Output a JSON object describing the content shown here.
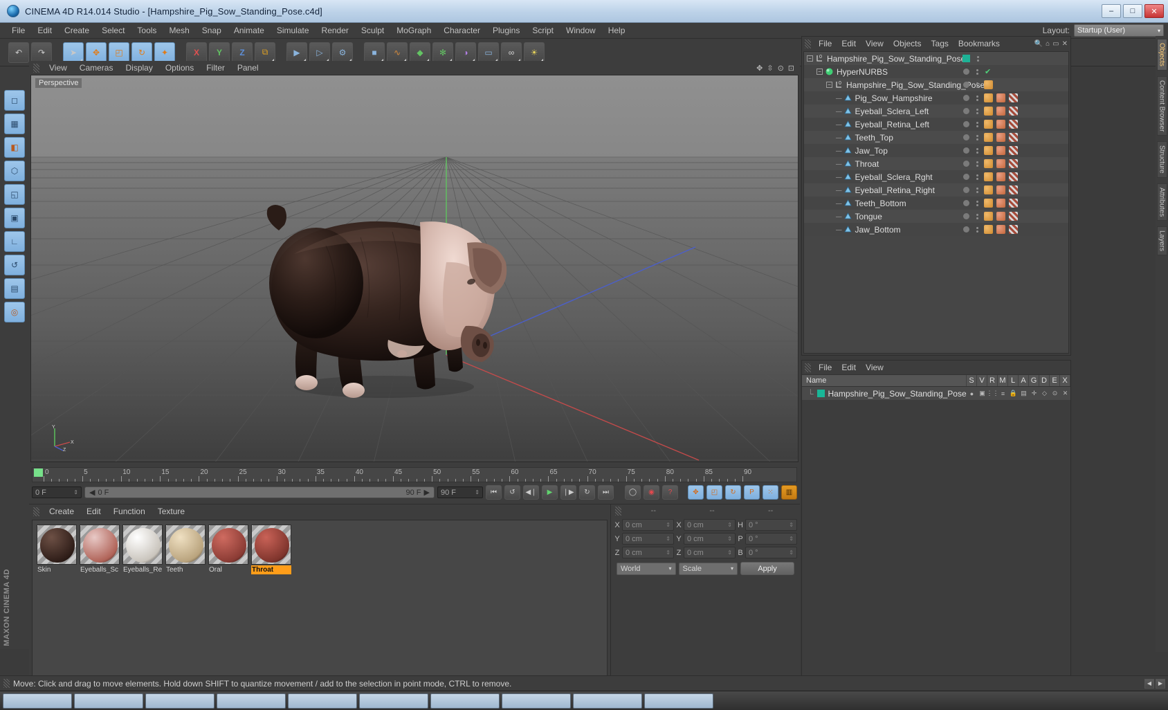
{
  "window": {
    "title": "CINEMA 4D R14.014 Studio - [Hampshire_Pig_Sow_Standing_Pose.c4d]",
    "app_icon": "c4d-logo-icon",
    "minimize": "–",
    "maximize": "□",
    "close": "✕"
  },
  "menubar": {
    "items": [
      "File",
      "Edit",
      "Create",
      "Select",
      "Tools",
      "Mesh",
      "Snap",
      "Animate",
      "Simulate",
      "Render",
      "Sculpt",
      "MoGraph",
      "Character",
      "Plugins",
      "Script",
      "Window",
      "Help"
    ],
    "layout_label": "Layout:",
    "layout_value": "Startup (User)",
    "layout_arrow": "▾"
  },
  "toolbar": {
    "buttons": [
      {
        "name": "undo-button",
        "glyph": "↶"
      },
      {
        "name": "redo-button",
        "glyph": "↷"
      },
      {
        "name": "select-tool-button",
        "glyph": "➤"
      },
      {
        "name": "move-tool-button",
        "glyph": "✥"
      },
      {
        "name": "scale-tool-button",
        "glyph": "◰"
      },
      {
        "name": "rotate-tool-button",
        "glyph": "↻"
      },
      {
        "name": "magnet-tool-button",
        "glyph": "✦"
      },
      {
        "name": "lock-x-axis-button",
        "glyph": "X"
      },
      {
        "name": "lock-y-axis-button",
        "glyph": "Y"
      },
      {
        "name": "lock-z-axis-button",
        "glyph": "Z"
      },
      {
        "name": "world-coordinates-button",
        "glyph": "⧉"
      },
      {
        "name": "render-view-button",
        "glyph": "▶"
      },
      {
        "name": "render-region-button",
        "glyph": "▷"
      },
      {
        "name": "render-settings-button",
        "glyph": "⚙"
      },
      {
        "name": "add-cube-button",
        "glyph": "■"
      },
      {
        "name": "add-spline-button",
        "glyph": "∿"
      },
      {
        "name": "add-nurbs-button",
        "glyph": "◆"
      },
      {
        "name": "add-array-button",
        "glyph": "✻"
      },
      {
        "name": "add-deformer-button",
        "glyph": "◑"
      },
      {
        "name": "add-camera-button",
        "glyph": "▭"
      },
      {
        "name": "add-scene-button",
        "glyph": "∞"
      },
      {
        "name": "add-light-button",
        "glyph": "☀"
      }
    ]
  },
  "left_palette": {
    "buttons": [
      {
        "name": "model-mode-button",
        "glyph": "◻"
      },
      {
        "name": "texture-mode-button",
        "glyph": "▦"
      },
      {
        "name": "polygon-mode-button",
        "glyph": "◧"
      },
      {
        "name": "points-mode-button",
        "glyph": "⬡"
      },
      {
        "name": "edges-mode-button",
        "glyph": "◱"
      },
      {
        "name": "object-axis-mode-button",
        "glyph": "▣"
      },
      {
        "name": "workplane-button",
        "glyph": "∟"
      },
      {
        "name": "enable-axis-button",
        "glyph": "↺"
      },
      {
        "name": "lock-workplane-button",
        "glyph": "▤"
      },
      {
        "name": "viewport-solo-button",
        "glyph": "◎"
      }
    ],
    "brand_line1": "MAXON",
    "brand_line2": "CINEMA 4D"
  },
  "viewport": {
    "menu": [
      "View",
      "Cameras",
      "Display",
      "Options",
      "Filter",
      "Panel"
    ],
    "label": "Perspective",
    "nav_icons": [
      "pan-icon",
      "zoom-icon",
      "orbit-icon",
      "maximize-viewport-icon"
    ],
    "axis_labels": {
      "y": "Y",
      "x": "X",
      "z": "Z"
    }
  },
  "timeline": {
    "ruler_labels": [
      "0",
      "5",
      "10",
      "15",
      "20",
      "25",
      "30",
      "35",
      "40",
      "45",
      "50",
      "55",
      "60",
      "65",
      "70",
      "75",
      "80",
      "85",
      "90"
    ],
    "current_frame": "0 F",
    "current_frame_right": "0 F",
    "scrub_value": "0 F",
    "preview_start": "0 F",
    "preview_end": "90 F",
    "end_frame": "90 F",
    "controls": [
      {
        "name": "go-to-start-button",
        "glyph": "⏮"
      },
      {
        "name": "play-backwards-button",
        "glyph": "↺"
      },
      {
        "name": "previous-frame-button",
        "glyph": "◀❘"
      },
      {
        "name": "play-forward-button",
        "glyph": "▶"
      },
      {
        "name": "next-frame-button",
        "glyph": "❘▶"
      },
      {
        "name": "play-loop-button",
        "glyph": "↻"
      },
      {
        "name": "go-to-end-button",
        "glyph": "⏭"
      },
      {
        "name": "record-active-objects-button",
        "glyph": "◯"
      },
      {
        "name": "autokeying-button",
        "glyph": "◉"
      },
      {
        "name": "keyframe-selection-button",
        "glyph": "?"
      },
      {
        "name": "position-key-button",
        "glyph": "✥"
      },
      {
        "name": "scale-key-button",
        "glyph": "◰"
      },
      {
        "name": "rotation-key-button",
        "glyph": "↻"
      },
      {
        "name": "pla-key-button",
        "glyph": "P"
      },
      {
        "name": "point-level-anim-button",
        "glyph": "⁙"
      },
      {
        "name": "timeline-toggle-button",
        "glyph": "▥"
      }
    ]
  },
  "material_manager": {
    "menu": [
      "Create",
      "Edit",
      "Function",
      "Texture"
    ],
    "materials": [
      {
        "name": "Skin",
        "color1": "#6d5045",
        "color2": "#2e1d18",
        "selected": false
      },
      {
        "name": "Eyeballs_Sc",
        "color1": "#e8c9c6",
        "color2": "#b06358",
        "selected": false
      },
      {
        "name": "Eyeballs_Re",
        "color1": "#ffffff",
        "color2": "#c9c4bc",
        "selected": false
      },
      {
        "name": "Teeth",
        "color1": "#efe0c2",
        "color2": "#b9a37d",
        "selected": false
      },
      {
        "name": "Oral",
        "color1": "#cf6b60",
        "color2": "#8a3b34",
        "selected": false
      },
      {
        "name": "Throat",
        "color1": "#c96257",
        "color2": "#7e342c",
        "selected": true
      }
    ]
  },
  "coordinates": {
    "header_dashes": [
      "--",
      "--",
      "--"
    ],
    "position": {
      "label_x": "X",
      "label_y": "Y",
      "label_z": "Z",
      "x": "0 cm",
      "y": "0 cm",
      "z": "0 cm"
    },
    "size": {
      "label_x": "X",
      "label_y": "Y",
      "label_z": "Z",
      "x": "0 cm",
      "y": "0 cm",
      "z": "0 cm"
    },
    "rotation": {
      "label_h": "H",
      "label_p": "P",
      "label_b": "B",
      "h": "0 °",
      "p": "0 °",
      "b": "0 °"
    },
    "coord_system": "World",
    "size_mode": "Scale",
    "apply_label": "Apply",
    "dropdown_arrow": "▾"
  },
  "object_manager": {
    "menu": [
      "File",
      "Edit",
      "View",
      "Objects",
      "Tags",
      "Bookmarks"
    ],
    "header_icons": [
      "search-icon",
      "home-icon",
      "minimize-panel-icon",
      "close-panel-icon"
    ],
    "items": [
      {
        "label": "Hampshire_Pig_Sow_Standing_Pose",
        "depth": 0,
        "icon": "null-object-icon",
        "expander": "−",
        "swatch": "#1db296",
        "check": false,
        "tags": 0
      },
      {
        "label": "HyperNURBS",
        "depth": 1,
        "icon": "hypernurbs-icon",
        "expander": "−",
        "swatch": "",
        "check": true,
        "tags": 0
      },
      {
        "label": "Hampshire_Pig_Sow_Standing_Pose",
        "depth": 2,
        "icon": "null-object-icon",
        "expander": "−",
        "swatch": "",
        "check": false,
        "tags": 1
      },
      {
        "label": "Pig_Sow_Hampshire",
        "depth": 3,
        "icon": "polygon-object-icon",
        "expander": "",
        "swatch": "",
        "check": false,
        "tags": 3
      },
      {
        "label": "Eyeball_Sclera_Left",
        "depth": 3,
        "icon": "polygon-object-icon",
        "expander": "",
        "swatch": "",
        "check": false,
        "tags": 3
      },
      {
        "label": "Eyeball_Retina_Left",
        "depth": 3,
        "icon": "polygon-object-icon",
        "expander": "",
        "swatch": "",
        "check": false,
        "tags": 3
      },
      {
        "label": "Teeth_Top",
        "depth": 3,
        "icon": "polygon-object-icon",
        "expander": "",
        "swatch": "",
        "check": false,
        "tags": 3
      },
      {
        "label": "Jaw_Top",
        "depth": 3,
        "icon": "polygon-object-icon",
        "expander": "",
        "swatch": "",
        "check": false,
        "tags": 3
      },
      {
        "label": "Throat",
        "depth": 3,
        "icon": "polygon-object-icon",
        "expander": "",
        "swatch": "",
        "check": false,
        "tags": 3
      },
      {
        "label": "Eyeball_Sclera_Rght",
        "depth": 3,
        "icon": "polygon-object-icon",
        "expander": "",
        "swatch": "",
        "check": false,
        "tags": 3
      },
      {
        "label": "Eyeball_Retina_Right",
        "depth": 3,
        "icon": "polygon-object-icon",
        "expander": "",
        "swatch": "",
        "check": false,
        "tags": 3
      },
      {
        "label": "Teeth_Bottom",
        "depth": 3,
        "icon": "polygon-object-icon",
        "expander": "",
        "swatch": "",
        "check": false,
        "tags": 3
      },
      {
        "label": "Tongue",
        "depth": 3,
        "icon": "polygon-object-icon",
        "expander": "",
        "swatch": "",
        "check": false,
        "tags": 3
      },
      {
        "label": "Jaw_Bottom",
        "depth": 3,
        "icon": "polygon-object-icon",
        "expander": "",
        "swatch": "",
        "check": false,
        "tags": 3
      }
    ]
  },
  "layers_panel": {
    "menu": [
      "File",
      "Edit",
      "View"
    ],
    "name_column": "Name",
    "columns": [
      "S",
      "V",
      "R",
      "M",
      "L",
      "A",
      "G",
      "D",
      "E",
      "X"
    ],
    "rows": [
      {
        "name": "Hampshire_Pig_Sow_Standing_Pose",
        "swatch": "#1db296"
      }
    ]
  },
  "right_tabs": [
    {
      "label": "Objects",
      "active": true
    },
    {
      "label": "Content Browser",
      "active": false
    },
    {
      "label": "Structure",
      "active": false
    },
    {
      "label": "Attributes",
      "active": false
    },
    {
      "label": "Layers",
      "active": false
    }
  ],
  "statusbar": {
    "text": "Move: Click and drag to move elements. Hold down SHIFT to quantize movement / add to the selection in point mode, CTRL to remove.",
    "nav_prev": "◀",
    "nav_next": "▶"
  },
  "colors": {
    "accent_orange": "#ff9d19",
    "panel_bg": "#3d3d3d",
    "field_bg": "#454545",
    "selected_blue": "#8fbbe3",
    "teal_swatch": "#1db296"
  }
}
